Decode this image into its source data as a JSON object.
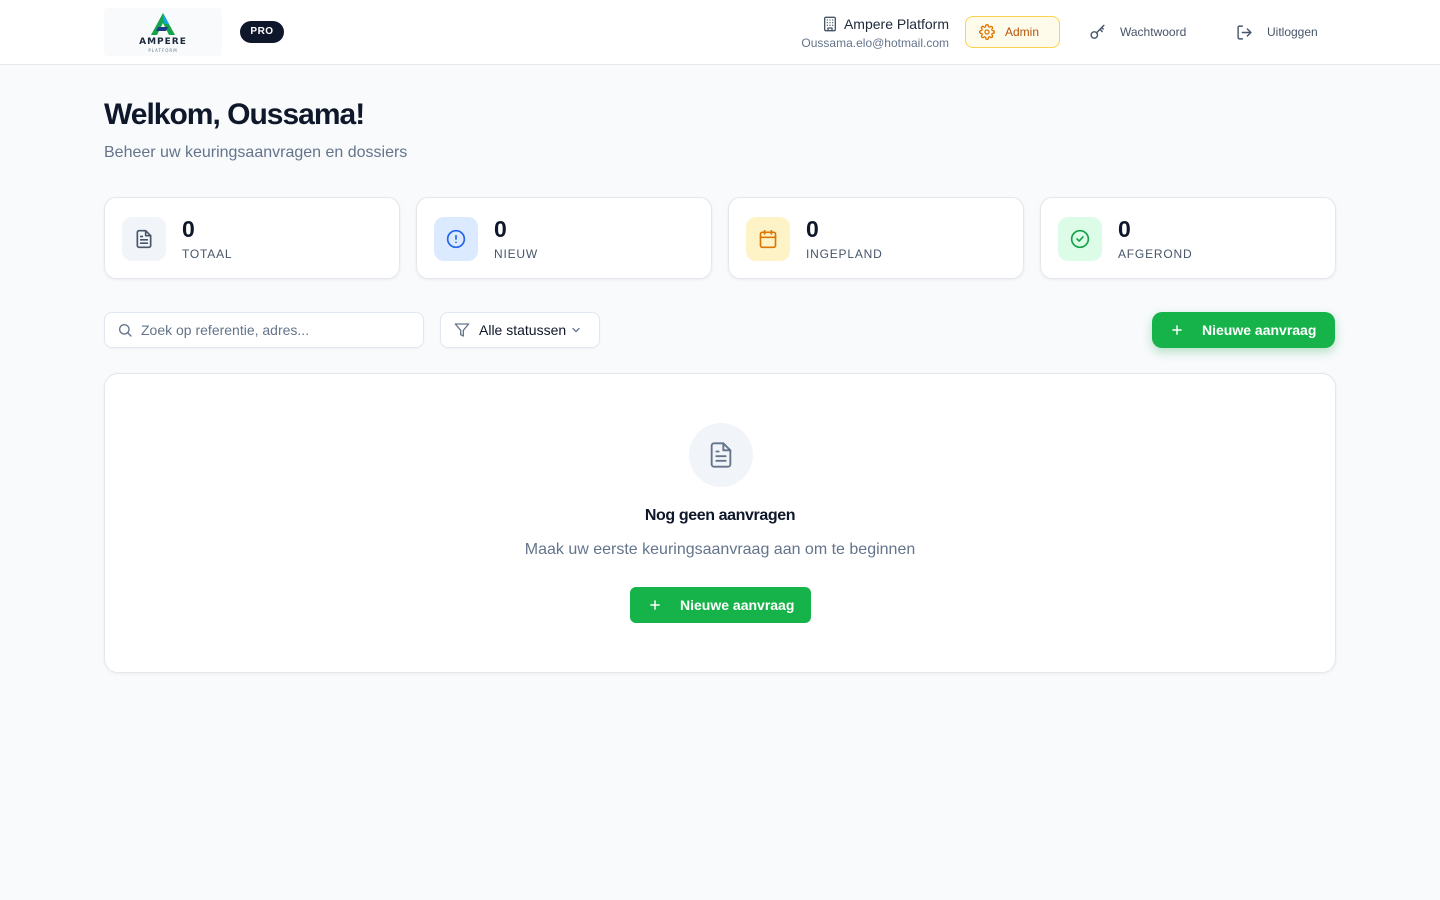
{
  "header": {
    "logo_text": "AMPERE",
    "logo_subtext": "PLATFORM",
    "plan_badge": "PRO",
    "org_name": "Ampere Platform",
    "user_email": "Oussama.elo@hotmail.com",
    "admin_label": "Admin",
    "password_label": "Wachtwoord",
    "logout_label": "Uitloggen"
  },
  "welcome": {
    "title": "Welkom, Oussama!",
    "subtitle": "Beheer uw keuringsaanvragen en dossiers"
  },
  "stats": [
    {
      "value": "0",
      "label": "TOTAAL",
      "icon": "document-icon",
      "color": "#475569",
      "bg": "#f1f5f9"
    },
    {
      "value": "0",
      "label": "NIEUW",
      "icon": "alert-circle-icon",
      "color": "#2563eb",
      "bg": "#dbeafe"
    },
    {
      "value": "0",
      "label": "INGEPLAND",
      "icon": "calendar-icon",
      "color": "#d97706",
      "bg": "#fef3c7"
    },
    {
      "value": "0",
      "label": "AFGEROND",
      "icon": "check-circle-icon",
      "color": "#16a34a",
      "bg": "#dcfce7"
    }
  ],
  "toolbar": {
    "search_placeholder": "Zoek op referentie, adres...",
    "search_value": "",
    "status_filter": "Alle statussen",
    "new_request_label": "Nieuwe aanvraag"
  },
  "empty_state": {
    "title": "Nog geen aanvragen",
    "description": "Maak uw eerste keuringsaanvraag aan om te beginnen",
    "button_label": "Nieuwe aanvraag"
  },
  "colors": {
    "accent_green": "#16b34a",
    "admin_amber": "#b45309",
    "page_background": "#f8fafc"
  }
}
